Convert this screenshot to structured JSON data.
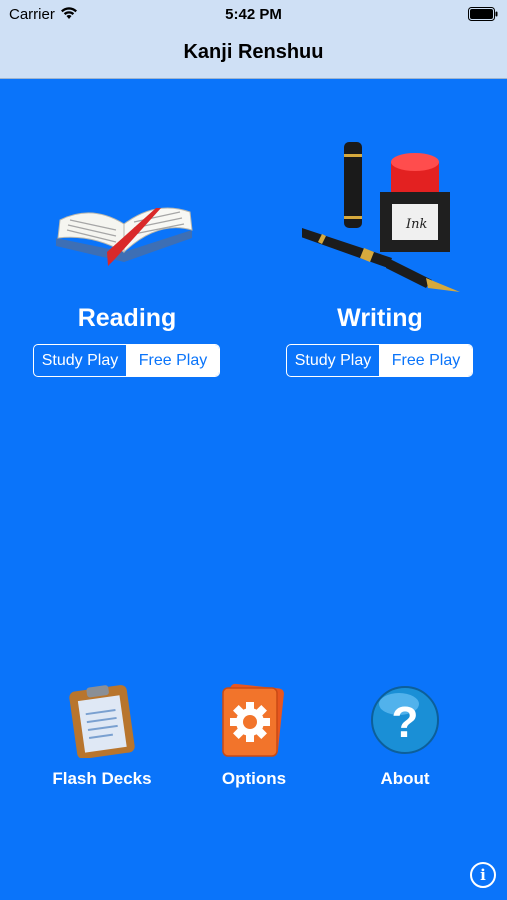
{
  "status_bar": {
    "carrier": "Carrier",
    "time": "5:42 PM"
  },
  "nav": {
    "title": "Kanji Renshuu"
  },
  "reading": {
    "title": "Reading",
    "segments": [
      "Study Play",
      "Free Play"
    ],
    "selected": "Study Play",
    "icon": "open-book-icon"
  },
  "writing": {
    "title": "Writing",
    "segments": [
      "Study Play",
      "Free Play"
    ],
    "selected": "Study Play",
    "icon": "pen-and-ink-icon"
  },
  "bottom": {
    "flash_decks": {
      "label": "Flash Decks",
      "icon": "clipboard-icon"
    },
    "options": {
      "label": "Options",
      "icon": "gear-icon"
    },
    "about": {
      "label": "About",
      "icon": "question-icon"
    }
  },
  "info_icon": "info-icon",
  "colors": {
    "background": "#0a74fa",
    "navbar": "#cfe0f5"
  }
}
